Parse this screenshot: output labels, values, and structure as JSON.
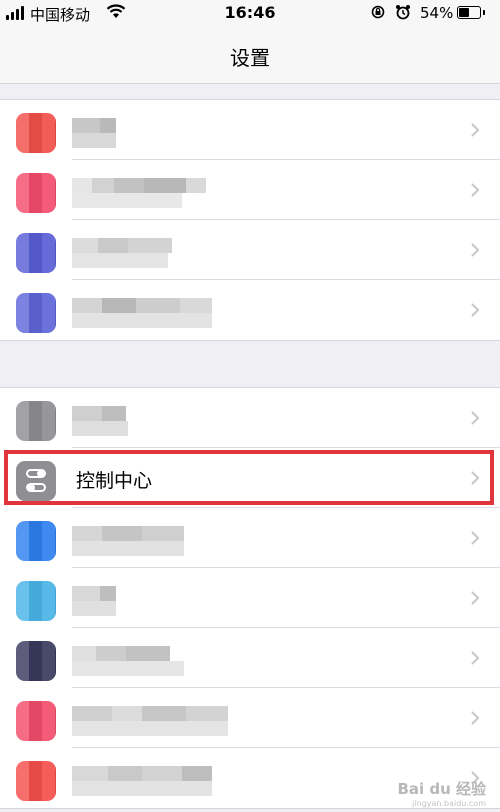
{
  "status_bar": {
    "carrier": "中国移动",
    "time": "16:46",
    "battery_percent": "54%",
    "battery_level": 0.54,
    "icons": [
      "signal-icon",
      "wifi-icon",
      "rotation-lock-icon",
      "alarm-icon",
      "battery-icon"
    ]
  },
  "nav": {
    "title": "设置"
  },
  "group1": {
    "items": [
      {
        "icon_color": "#f2504a"
      },
      {
        "icon_color": "#f44d6e"
      },
      {
        "icon_color": "#5a5fd6"
      },
      {
        "icon_color": "#6067d8"
      }
    ]
  },
  "group2": {
    "items": [
      {
        "icon_color": "#8e8e93"
      },
      {
        "label": "控制中心",
        "icon": "control-center-icon",
        "icon_color": "#8e8e93"
      },
      {
        "icon_color": "#2f80f0"
      },
      {
        "icon_color": "#4ab4e8"
      },
      {
        "icon_color": "#3a3a5e"
      },
      {
        "icon_color": "#f24e6b"
      },
      {
        "icon_color": "#f5504c"
      }
    ]
  },
  "highlight_color": "#e2343c",
  "watermark": {
    "text": "Bai du 经验",
    "sub": "jingyan.baidu.com"
  }
}
